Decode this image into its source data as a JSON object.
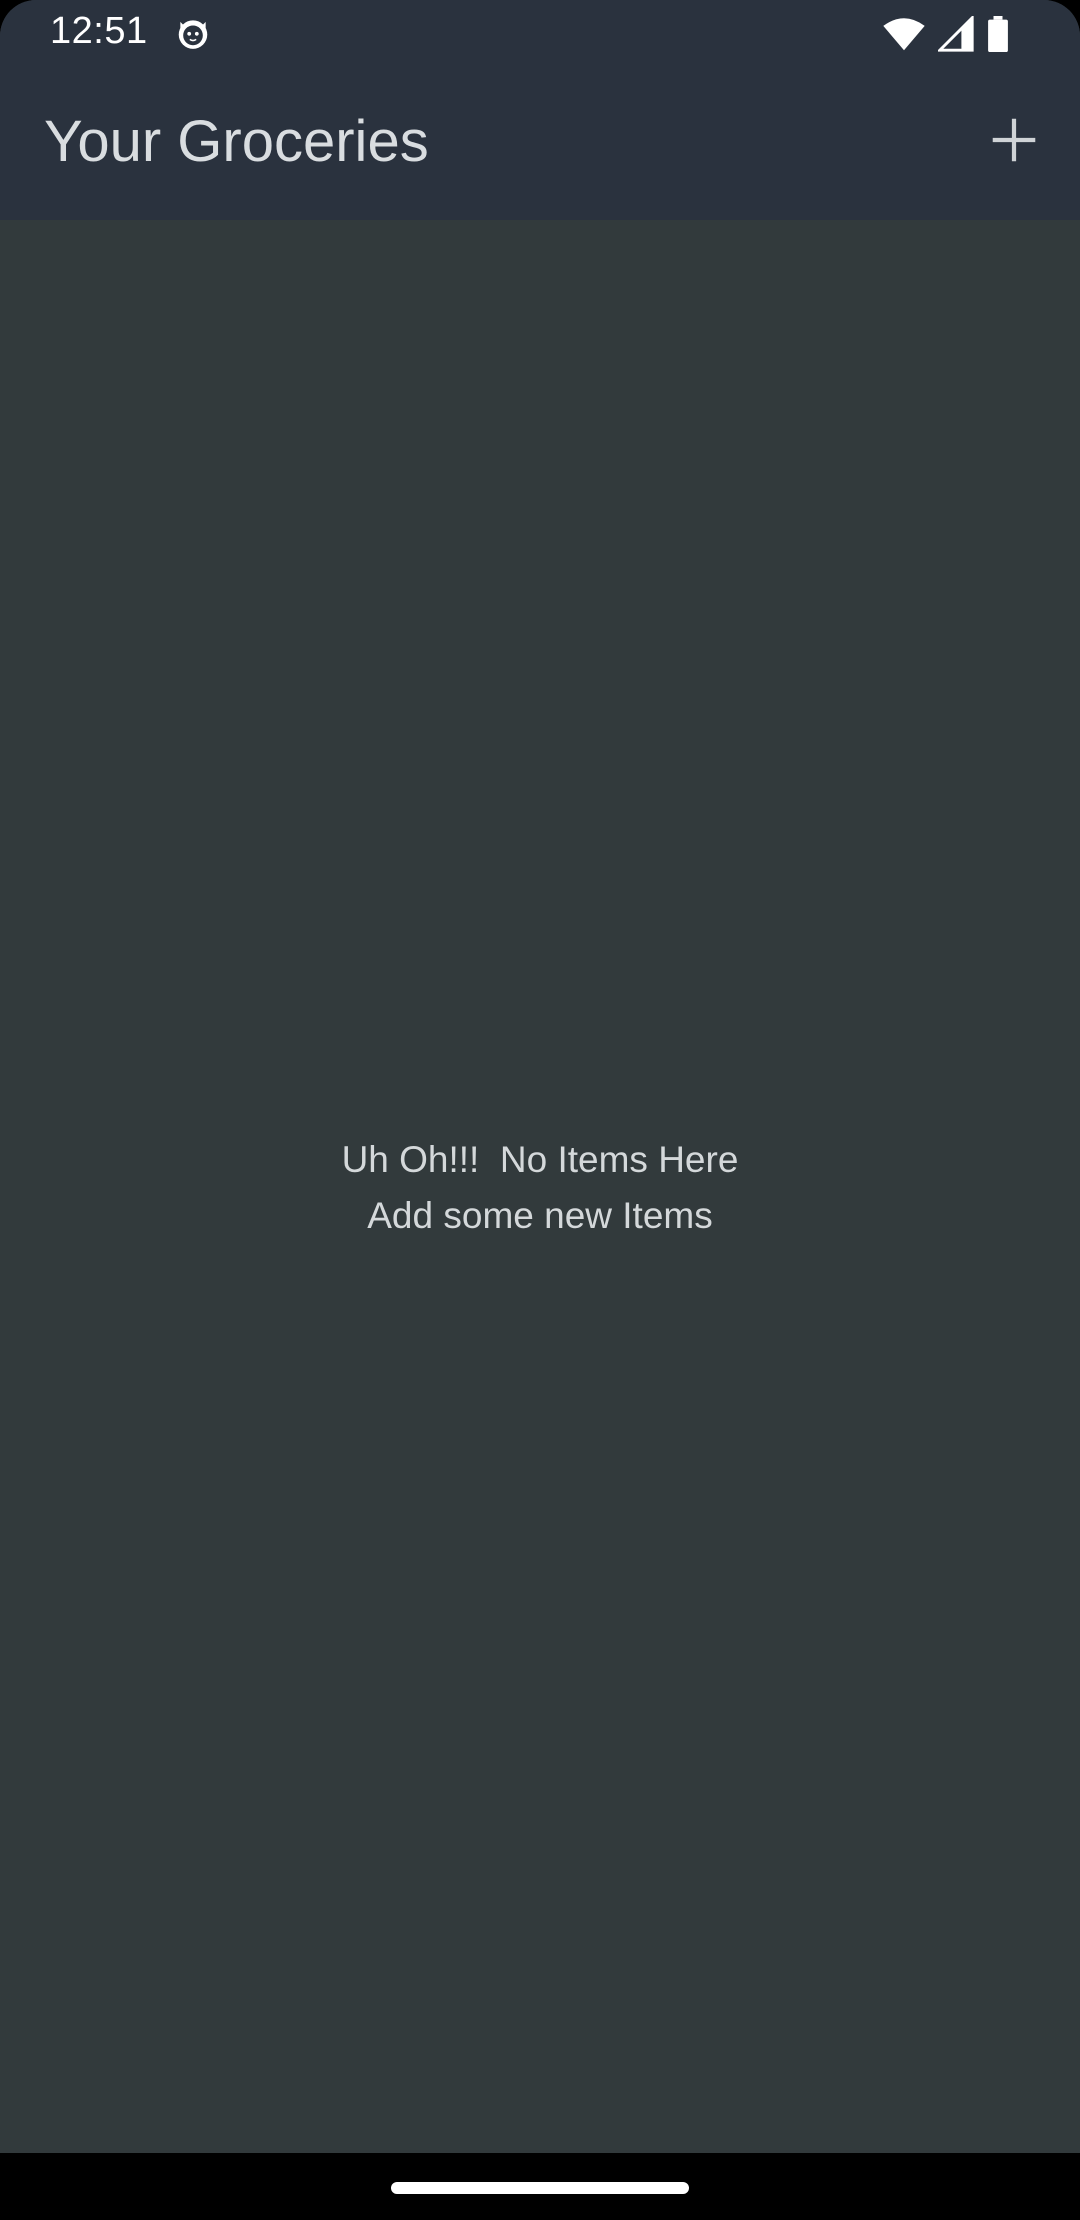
{
  "status_bar": {
    "time": "12:51",
    "notification_icon": "cat-face-icon",
    "wifi_icon": "wifi-icon",
    "signal_icon": "cellular-signal-icon",
    "battery_icon": "battery-icon"
  },
  "app_bar": {
    "title": "Your Groceries",
    "add_icon": "plus-icon"
  },
  "empty_state": {
    "line1": "Uh Oh!!!  No Items Here",
    "line2": "Add some new Items"
  },
  "colors": {
    "app_bar_bg": "#2a323e",
    "content_bg": "#323a3c",
    "title_text": "#d9dde0",
    "body_text": "#d4d8da",
    "nav_bar_bg": "#000000"
  }
}
